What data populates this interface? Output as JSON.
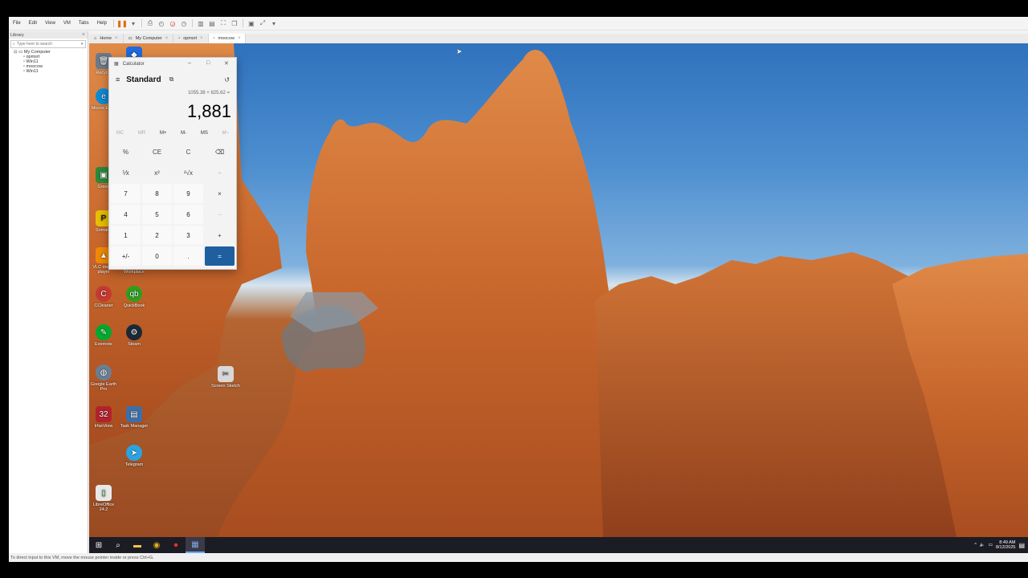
{
  "menubar": {
    "items": [
      "File",
      "Edit",
      "View",
      "VM",
      "Tabs",
      "Help"
    ]
  },
  "library": {
    "title": "Library",
    "close": "×",
    "search_placeholder": "Type here to search",
    "tree": [
      {
        "label": "My Computer",
        "level": 0
      },
      {
        "label": "opmsrt",
        "level": 1
      },
      {
        "label": "Win11",
        "level": 1
      },
      {
        "label": "moocow",
        "level": 1
      },
      {
        "label": "Win11",
        "level": 1
      }
    ]
  },
  "tabs": [
    {
      "label": "Home"
    },
    {
      "label": "My Computer"
    },
    {
      "label": "opmsrt"
    },
    {
      "label": "moocow",
      "active": true
    }
  ],
  "statusbar": {
    "text": "To direct input to this VM, move the mouse pointer inside or press Ctrl+G."
  },
  "desktop": {
    "icons": [
      {
        "label": "Recycle",
        "color": "#6b7a8c"
      },
      {
        "label": "",
        "color": "#1e6ae0"
      },
      {
        "label": "Micros Edge",
        "color": "#0c8bd6"
      },
      {
        "label": "Green",
        "color": "#2a8a3a"
      },
      {
        "label": "Somatni",
        "color": "#e6c000"
      },
      {
        "label": "VLC media player",
        "color": "#f08a00"
      },
      {
        "label": "Zoom Workplace",
        "color": "#2d8cff"
      },
      {
        "label": "CCleaner",
        "color": "#c43a30"
      },
      {
        "label": "QuickBook",
        "color": "#2ca01c"
      },
      {
        "label": "Evernote",
        "color": "#00a82d"
      },
      {
        "label": "Steam",
        "color": "#1b2838"
      },
      {
        "label": "Google Earth Pro",
        "color": "#6a7f95"
      },
      {
        "label": "Screen Sketch",
        "color": "#d8d8d8"
      },
      {
        "label": "IrfanView",
        "color": "#b3222a"
      },
      {
        "label": "Task Manager",
        "color": "#3d6fa8"
      },
      {
        "label": "Telegram",
        "color": "#2aa3df"
      },
      {
        "label": "LibreOffice 24.2",
        "color": "#e8e8e8"
      }
    ]
  },
  "calculator": {
    "title": "Calculator",
    "mode": "Standard",
    "expression": "1055.38 + 825.62 =",
    "display": "1,881",
    "memory": [
      "MC",
      "MR",
      "M+",
      "M-",
      "MS",
      "M~"
    ],
    "keys": [
      [
        "%",
        "CE",
        "C",
        "⌫"
      ],
      [
        "⅟x",
        "x²",
        "²√x",
        "÷"
      ],
      [
        "7",
        "8",
        "9",
        "×"
      ],
      [
        "4",
        "5",
        "6",
        "−"
      ],
      [
        "1",
        "2",
        "3",
        "+"
      ],
      [
        "+/-",
        "0",
        ".",
        "="
      ]
    ]
  },
  "taskbar": {
    "clock_time": "8:49 AM",
    "clock_date": "8/12/2025"
  }
}
